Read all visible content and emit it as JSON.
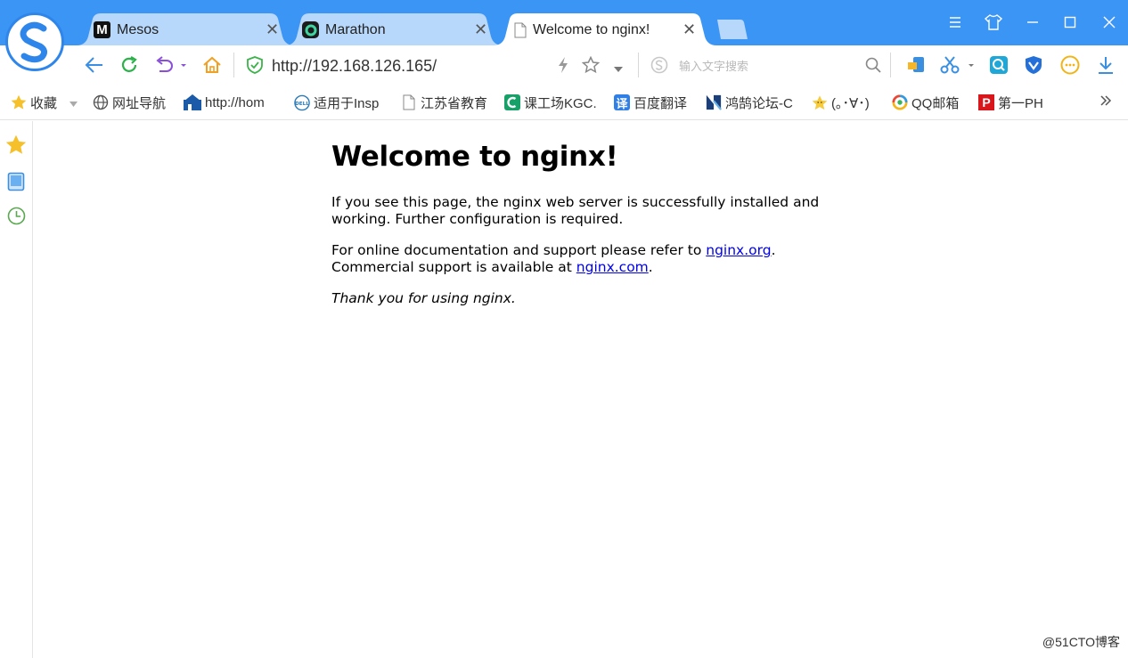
{
  "tabs": [
    {
      "title": "Mesos",
      "favicon": "M"
    },
    {
      "title": "Marathon"
    },
    {
      "title": "Welcome to nginx!",
      "active": true
    }
  ],
  "address_bar": {
    "url": "http://192.168.126.165/"
  },
  "search": {
    "placeholder": "输入文字搜索"
  },
  "bookmarks": [
    {
      "label": "收藏",
      "icon": "star-icon"
    },
    {
      "label": "网址导航",
      "icon": "globe-icon"
    },
    {
      "label": "http://hom",
      "icon": "home-page-icon"
    },
    {
      "label": "适用于Insp",
      "icon": "dell-icon"
    },
    {
      "label": "江苏省教育",
      "icon": "page-icon"
    },
    {
      "label": "课工场KGC.",
      "icon": "kgc-icon"
    },
    {
      "label": "百度翻译",
      "icon": "translate-icon",
      "glyph": "译"
    },
    {
      "label": "鸿鹄论坛-C",
      "icon": "n-logo-icon"
    },
    {
      "label": "(｡･∀･)",
      "icon": "star-smile-icon"
    },
    {
      "label": "QQ邮箱",
      "icon": "qq-mail-icon"
    },
    {
      "label": "第一PH",
      "icon": "p-logo-icon",
      "glyph": "P"
    }
  ],
  "page": {
    "heading": "Welcome to nginx!",
    "para1_line1": "If you see this page, the nginx web server is successfully installed and",
    "para1_line2": "working. Further configuration is required.",
    "para2_line1_text": "For online documentation and support please refer to ",
    "para2_link1": "nginx.org",
    "para2_line1_end": ".",
    "para2_line2_text": "Commercial support is available at ",
    "para2_link2": "nginx.com",
    "para2_line2_end": ".",
    "thanks": "Thank you for using nginx."
  },
  "watermark": "@51CTO博客",
  "colors": {
    "titlebar": "#3b95f5",
    "inactive_tab": "#b7d7fb",
    "active_tab": "#ffffff",
    "link": "#0000ee"
  }
}
